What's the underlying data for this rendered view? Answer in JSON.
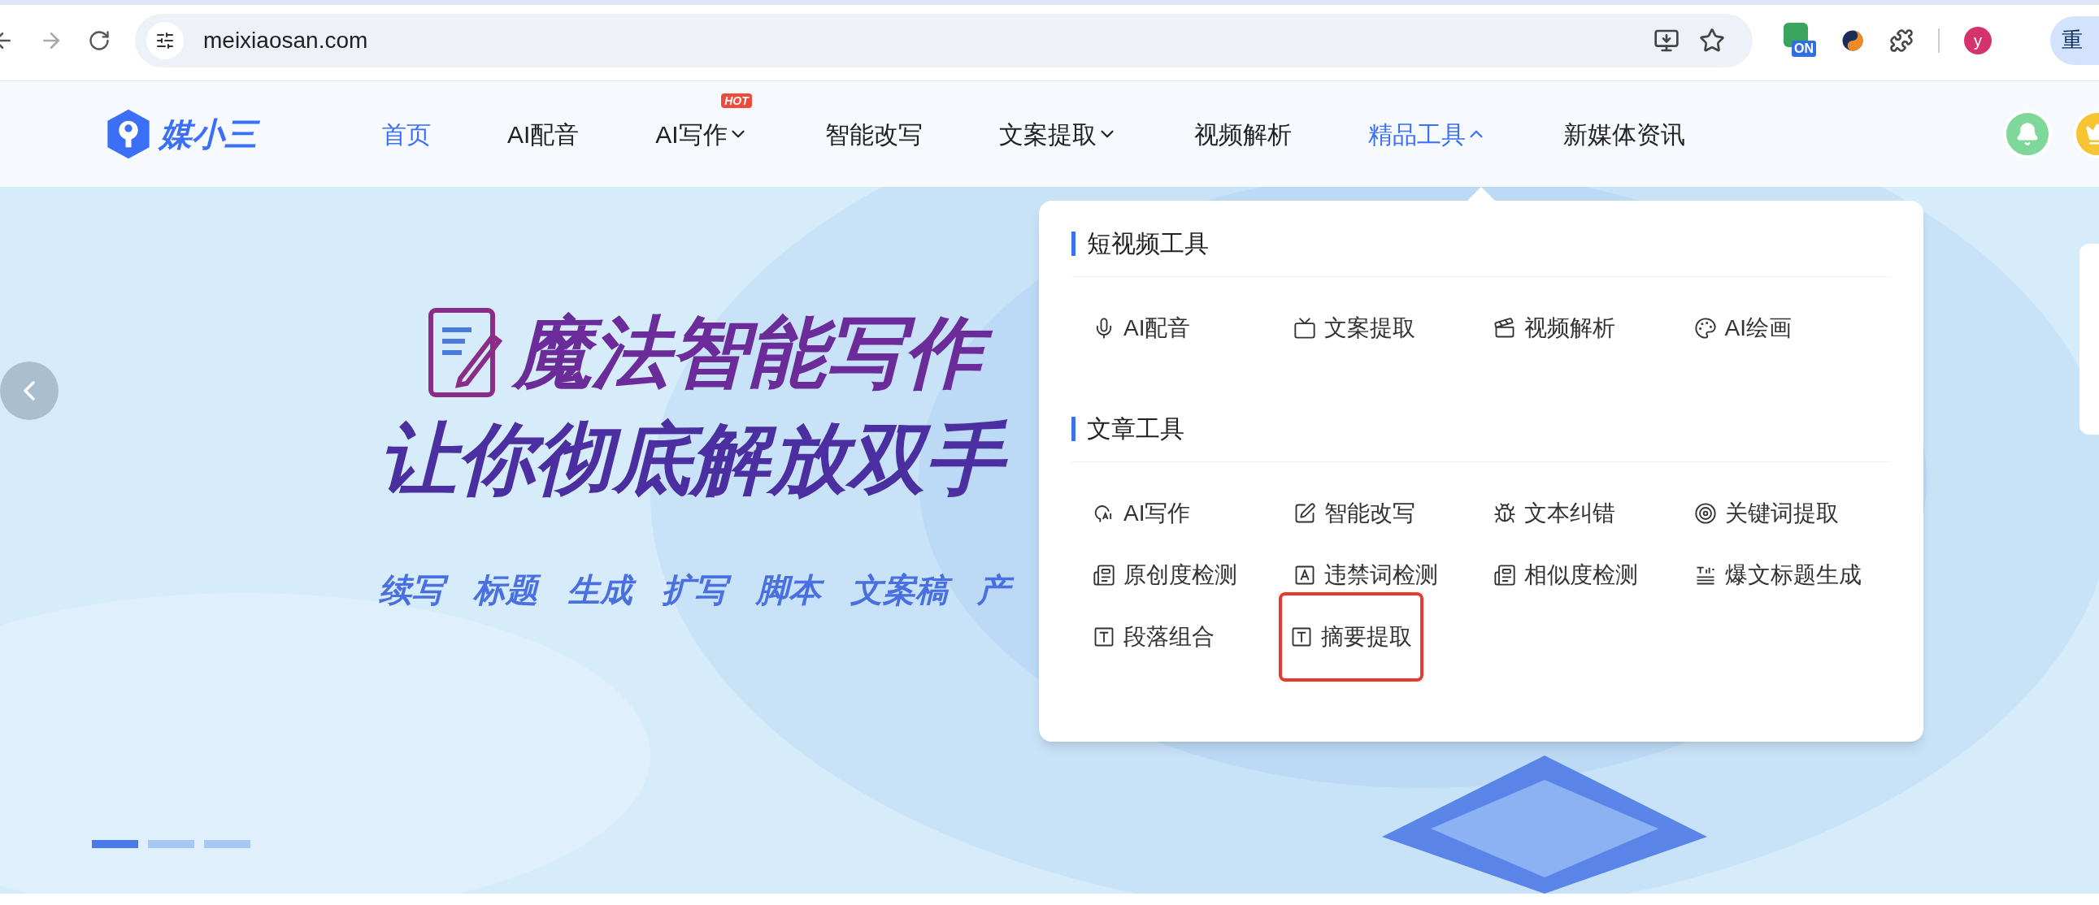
{
  "browser": {
    "url": "meixiaosan.com",
    "extension_badge": "ON",
    "profile_initial": "y",
    "side_button": "重"
  },
  "site": {
    "logo_text": "媒小三"
  },
  "nav": {
    "items": [
      {
        "label": "首页",
        "selected": true,
        "kind": "link"
      },
      {
        "label": "AI配音",
        "selected": false,
        "kind": "link"
      },
      {
        "label": "AI写作",
        "selected": false,
        "kind": "menu",
        "expanded": false,
        "badge": "HOT"
      },
      {
        "label": "智能改写",
        "selected": false,
        "kind": "link"
      },
      {
        "label": "文案提取",
        "selected": false,
        "kind": "menu",
        "expanded": false
      },
      {
        "label": "视频解析",
        "selected": false,
        "kind": "link"
      },
      {
        "label": "精品工具",
        "selected": true,
        "kind": "menu",
        "expanded": true
      },
      {
        "label": "新媒体资讯",
        "selected": false,
        "kind": "link"
      }
    ]
  },
  "banner": {
    "headline": [
      "魔法智能写作",
      "让你彻底解放双手"
    ],
    "tags": [
      "续写",
      "标题",
      "生成",
      "扩写",
      "脚本",
      "文案稿",
      "产"
    ],
    "slides": [
      {
        "selected": true
      },
      {
        "selected": false
      },
      {
        "selected": false
      }
    ]
  },
  "dropdown": {
    "sections": [
      {
        "title": "短视频工具",
        "items": [
          {
            "label": "AI配音",
            "highlighted": false
          },
          {
            "label": "文案提取",
            "highlighted": false
          },
          {
            "label": "视频解析",
            "highlighted": false
          },
          {
            "label": "AI绘画",
            "highlighted": false
          }
        ]
      },
      {
        "title": "文章工具",
        "items": [
          {
            "label": "AI写作",
            "highlighted": false
          },
          {
            "label": "智能改写",
            "highlighted": false
          },
          {
            "label": "文本纠错",
            "highlighted": false
          },
          {
            "label": "关键词提取",
            "highlighted": false
          },
          {
            "label": "原创度检测",
            "highlighted": false
          },
          {
            "label": "违禁词检测",
            "highlighted": false
          },
          {
            "label": "相似度检测",
            "highlighted": false
          },
          {
            "label": "爆文标题生成",
            "highlighted": false
          },
          {
            "label": "段落组合",
            "highlighted": false
          },
          {
            "label": "摘要提取",
            "highlighted": true
          }
        ]
      }
    ]
  }
}
